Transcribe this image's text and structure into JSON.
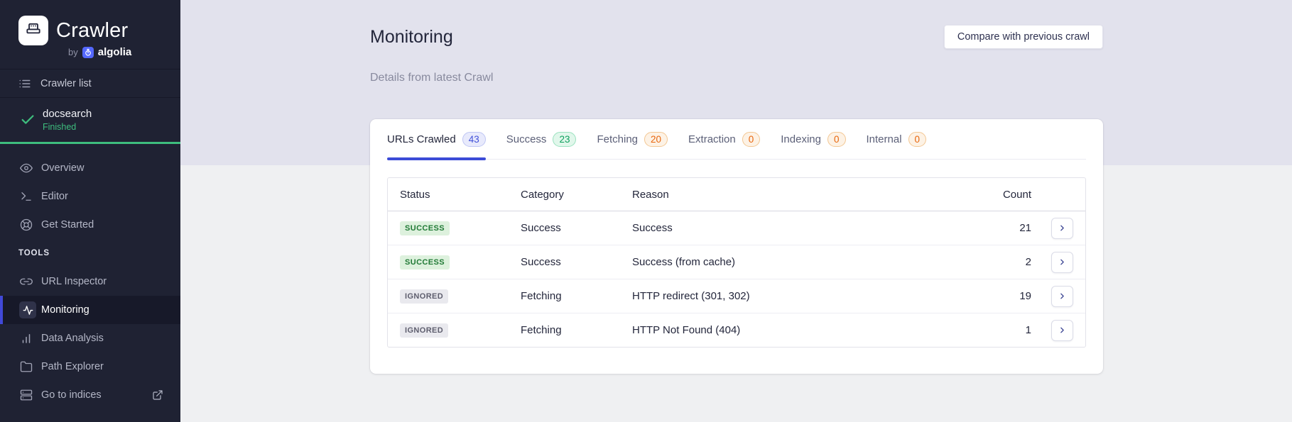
{
  "sidebar": {
    "logo": {
      "product": "Crawler",
      "by": "by",
      "brand": "algolia"
    },
    "crawler_list_label": "Crawler list",
    "crawler": {
      "name": "docsearch",
      "state": "Finished"
    },
    "nav": [
      {
        "label": "Overview",
        "icon": "eye-icon"
      },
      {
        "label": "Editor",
        "icon": "terminal-icon"
      },
      {
        "label": "Get Started",
        "icon": "lifebuoy-icon"
      }
    ],
    "tools_heading": "TOOLS",
    "tools_nav": [
      {
        "label": "URL Inspector",
        "icon": "link-icon"
      },
      {
        "label": "Monitoring",
        "icon": "activity-icon",
        "active": true
      },
      {
        "label": "Data Analysis",
        "icon": "bar-chart-icon"
      },
      {
        "label": "Path Explorer",
        "icon": "folder-icon"
      },
      {
        "label": "Go to indices",
        "icon": "indices-icon",
        "trailing_icon": "external-link-icon"
      }
    ]
  },
  "header": {
    "title": "Monitoring",
    "subtitle": "Details from latest Crawl",
    "compare_button": "Compare with previous crawl"
  },
  "tabs": [
    {
      "label": "URLs Crawled",
      "count": "43",
      "badge_color": "blue",
      "active": true
    },
    {
      "label": "Success",
      "count": "23",
      "badge_color": "green",
      "active": false
    },
    {
      "label": "Fetching",
      "count": "20",
      "badge_color": "orange",
      "active": false
    },
    {
      "label": "Extraction",
      "count": "0",
      "badge_color": "orange",
      "active": false
    },
    {
      "label": "Indexing",
      "count": "0",
      "badge_color": "orange",
      "active": false
    },
    {
      "label": "Internal",
      "count": "0",
      "badge_color": "orange",
      "active": false
    }
  ],
  "table": {
    "columns": [
      "Status",
      "Category",
      "Reason",
      "Count"
    ],
    "rows": [
      {
        "status": "SUCCESS",
        "variant": "success",
        "category": "Success",
        "reason": "Success",
        "count": "21"
      },
      {
        "status": "SUCCESS",
        "variant": "success",
        "category": "Success",
        "reason": "Success (from cache)",
        "count": "2"
      },
      {
        "status": "IGNORED",
        "variant": "ignored",
        "category": "Fetching",
        "reason": "HTTP redirect (301, 302)",
        "count": "19"
      },
      {
        "status": "IGNORED",
        "variant": "ignored",
        "category": "Fetching",
        "reason": "HTTP Not Found (404)",
        "count": "1"
      }
    ]
  },
  "colors": {
    "sidebar_bg": "#1f2233",
    "active_accent": "#4149d8",
    "success_green": "#3ebd7e",
    "algolia_blue": "#5468ff",
    "tab_underline": "#3c4bd7",
    "text_dark": "#23263b",
    "band_top_bg": "#e2e2ed",
    "band_bottom_bg": "#eff0f2"
  }
}
